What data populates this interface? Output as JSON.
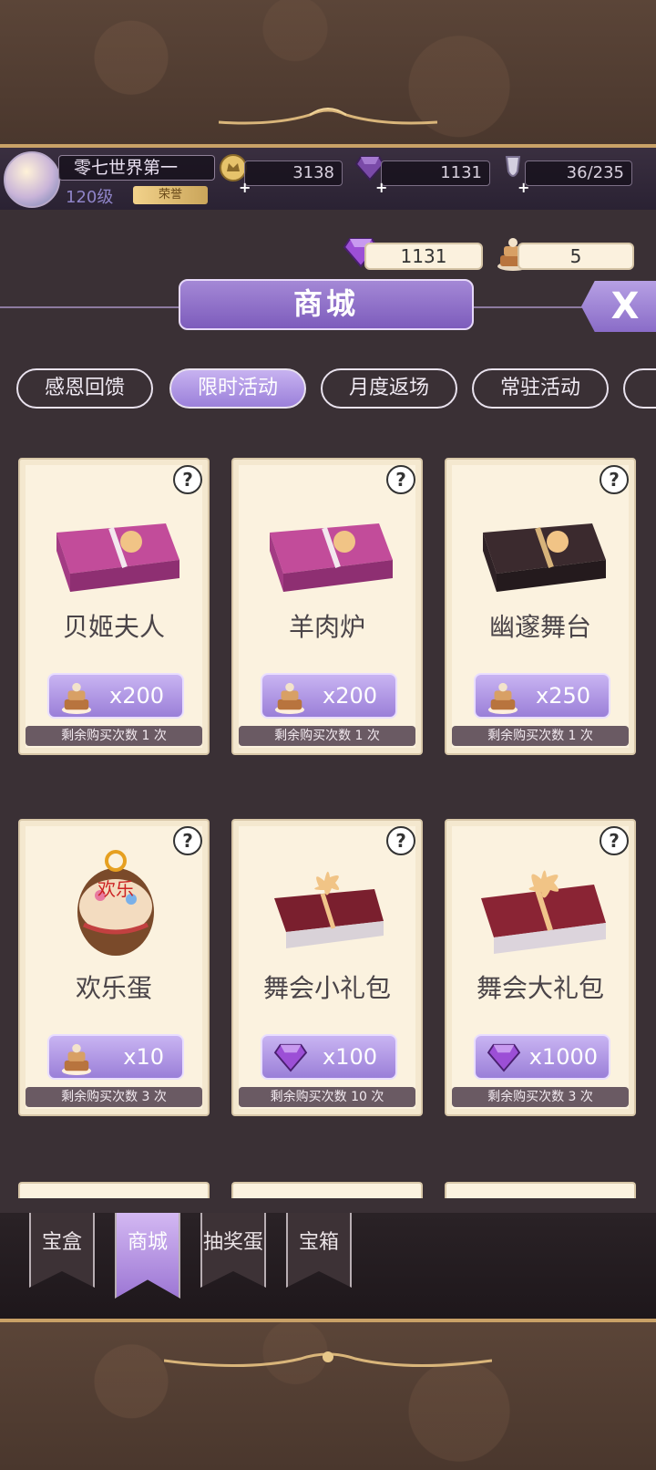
{
  "player": {
    "name": "零七世界第一",
    "level": "120级",
    "badge": "荣誉"
  },
  "resources": {
    "gold": "3138",
    "gems": "1131",
    "stamina": "36/235"
  },
  "currency": {
    "gems": "1131",
    "cakes": "5"
  },
  "shop": {
    "title": "商城",
    "close_label": "X"
  },
  "tabs": [
    {
      "label": "感恩回馈",
      "active": false
    },
    {
      "label": "限时活动",
      "active": true
    },
    {
      "label": "月度返场",
      "active": false
    },
    {
      "label": "常驻活动",
      "active": false
    }
  ],
  "items": [
    {
      "name": "贝姬夫人",
      "price": "x200",
      "currency": "cake-icon",
      "remaining": "剩余购买次数 1 次"
    },
    {
      "name": "羊肉炉",
      "price": "x200",
      "currency": "cake-icon",
      "remaining": "剩余购买次数 1 次"
    },
    {
      "name": "幽邃舞台",
      "price": "x250",
      "currency": "cake-icon",
      "remaining": "剩余购买次数 1 次"
    },
    {
      "name": "欢乐蛋",
      "price": "x10",
      "currency": "cake-icon",
      "remaining": "剩余购买次数 3 次"
    },
    {
      "name": "舞会小礼包",
      "price": "x100",
      "currency": "gem-icon",
      "remaining": "剩余购买次数 10 次"
    },
    {
      "name": "舞会大礼包",
      "price": "x1000",
      "currency": "gem-icon",
      "remaining": "剩余购买次数 3 次"
    }
  ],
  "help_label": "?",
  "egg_text": "欢乐",
  "bottom_nav": [
    {
      "label": "宝盒",
      "active": false
    },
    {
      "label": "商城",
      "active": true
    },
    {
      "label": "抽奖蛋",
      "active": false
    },
    {
      "label": "宝箱",
      "active": false
    }
  ],
  "colors": {
    "accent_purple": "#9b80da",
    "card_bg": "#fbf2df",
    "gold_trim": "#c9a167"
  }
}
